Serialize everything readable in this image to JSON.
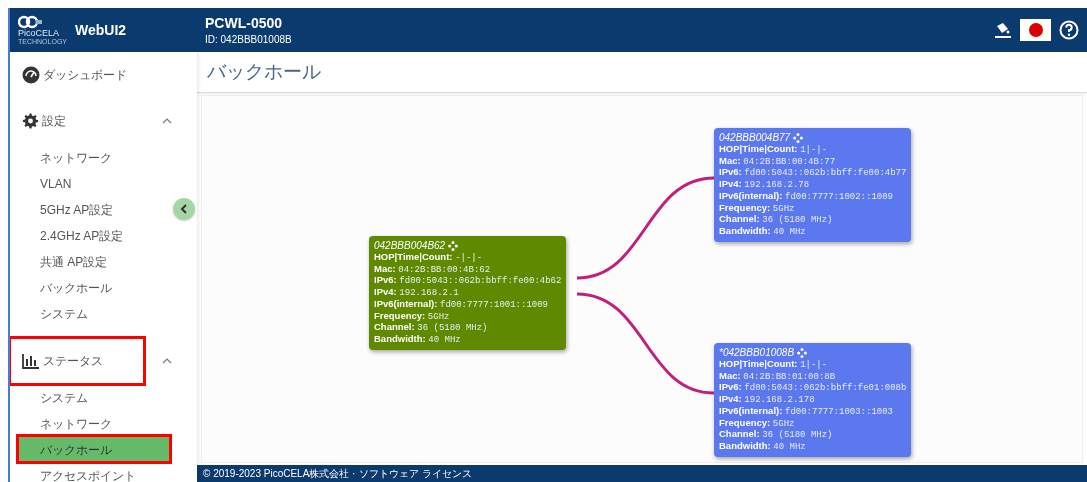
{
  "header": {
    "logo_text": "PicoCELA",
    "logo_subtext": "TECHNOLOGY",
    "app_name": "WebUI2",
    "device_name": "PCWL-0500",
    "device_id": "ID: 042BBB01008B"
  },
  "sidebar": {
    "items": [
      {
        "kind": "link",
        "label": "ダッシュボード",
        "selected": false,
        "highlighted": false
      },
      {
        "kind": "section",
        "label": "設定",
        "expanded": true,
        "highlighted": false,
        "children": [
          {
            "label": "ネットワーク",
            "selected": false,
            "highlighted": false
          },
          {
            "label": "VLAN",
            "selected": false,
            "highlighted": false
          },
          {
            "label": "5GHz AP設定",
            "selected": false,
            "highlighted": false
          },
          {
            "label": "2.4GHz AP設定",
            "selected": false,
            "highlighted": false
          },
          {
            "label": "共通 AP設定",
            "selected": false,
            "highlighted": false
          },
          {
            "label": "バックホール",
            "selected": false,
            "highlighted": false
          },
          {
            "label": "システム",
            "selected": false,
            "highlighted": false
          }
        ]
      },
      {
        "kind": "section",
        "label": "ステータス",
        "expanded": true,
        "highlighted": true,
        "children": [
          {
            "label": "システム",
            "selected": false,
            "highlighted": false
          },
          {
            "label": "ネットワーク",
            "selected": false,
            "highlighted": false
          },
          {
            "label": "バックホール",
            "selected": true,
            "highlighted": true
          },
          {
            "label": "アクセスポイント",
            "selected": false,
            "highlighted": false
          }
        ]
      }
    ]
  },
  "page_title": "バックホール",
  "root_node": {
    "title": "042BBB004B62",
    "color": "#5f8a00",
    "fields": [
      {
        "label": "HOP|Time|Count:",
        "value": "-|-|-"
      },
      {
        "label": "Mac:",
        "value": "04:2B:BB:00:4B:62"
      },
      {
        "label": "IPv6:",
        "value": "fd00:5043::062b:bbff:fe00:4b62"
      },
      {
        "label": "IPv4:",
        "value": "192.168.2.1"
      },
      {
        "label": "IPv6(internal):",
        "value": "fd00:7777:1001::1009"
      },
      {
        "label": "Frequency:",
        "value": "5GHz"
      },
      {
        "label": "Channel:",
        "value": "36 (5180 MHz)"
      },
      {
        "label": "Bandwidth:",
        "value": "40 MHz"
      }
    ],
    "children": [
      {
        "title": "042BBB004B77",
        "color": "#5b78ee",
        "fields": [
          {
            "label": "HOP|Time|Count:",
            "value": "1|-|-"
          },
          {
            "label": "Mac:",
            "value": "04:2B:BB:00:4B:77"
          },
          {
            "label": "IPv6:",
            "value": "fd00:5043::062b:bbff:fe00:4b77"
          },
          {
            "label": "IPv4:",
            "value": "192.168.2.78"
          },
          {
            "label": "IPv6(internal):",
            "value": "fd00:7777:1002::1009"
          },
          {
            "label": "Frequency:",
            "value": "5GHz"
          },
          {
            "label": "Channel:",
            "value": "36 (5180 MHz)"
          },
          {
            "label": "Bandwidth:",
            "value": "40 MHz"
          }
        ]
      },
      {
        "title": "*042BBB01008B",
        "color": "#5b78ee",
        "fields": [
          {
            "label": "HOP|Time|Count:",
            "value": "1|-|-"
          },
          {
            "label": "Mac:",
            "value": "04:2B:BB:01:00:8B"
          },
          {
            "label": "IPv6:",
            "value": "fd00:5043::062b:bbff:fe01:008b"
          },
          {
            "label": "IPv4:",
            "value": "192.168.2.178"
          },
          {
            "label": "IPv6(internal):",
            "value": "fd00:7777:1003::1003"
          },
          {
            "label": "Frequency:",
            "value": "5GHz"
          },
          {
            "label": "Channel:",
            "value": "36 (5180 MHz)"
          },
          {
            "label": "Bandwidth:",
            "value": "40 MHz"
          }
        ]
      }
    ]
  },
  "footer": {
    "copyright": "© 2019-2023 PicoCELA株式会社 ·",
    "link": "ソフトウェア ライセンス"
  }
}
